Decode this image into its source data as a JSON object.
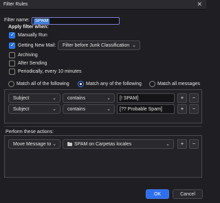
{
  "window": {
    "title": "Filter Rules"
  },
  "filter_name": {
    "label": "Filter name:",
    "value": "SPAM"
  },
  "apply_when": {
    "heading": "Apply filter when:",
    "manually_run": {
      "label": "Manually Run",
      "checked": true
    },
    "getting_new_mail": {
      "label": "Getting New Mail:",
      "checked": true,
      "option": "Filter before Junk Classification"
    },
    "archiving": {
      "label": "Archiving",
      "checked": false
    },
    "after_sending": {
      "label": "After Sending",
      "checked": false
    },
    "periodically": {
      "label": "Periodically, every 10 minutes",
      "checked": false
    }
  },
  "match": {
    "all": "Match all of the following",
    "any": "Match any of the following",
    "all_messages": "Match all messages",
    "selected": "any"
  },
  "rules": [
    {
      "field": "Subject",
      "operator": "contains",
      "value": "[! SPAM]"
    },
    {
      "field": "Subject",
      "operator": "contains",
      "value": "[?? Probable Spam]"
    }
  ],
  "actions": {
    "heading": "Perform these actions:",
    "items": [
      {
        "action": "Move Message to",
        "target": "SPAM on Carpetas locales"
      }
    ]
  },
  "buttons": {
    "ok": "OK",
    "cancel": "Cancel",
    "add": "+",
    "remove": "−"
  },
  "icons": {
    "close": "close-icon",
    "folder": "folder-icon",
    "chevron": "chevron-down-icon"
  },
  "colors": {
    "accent": "#2f6fed",
    "background": "#1f1f23"
  }
}
